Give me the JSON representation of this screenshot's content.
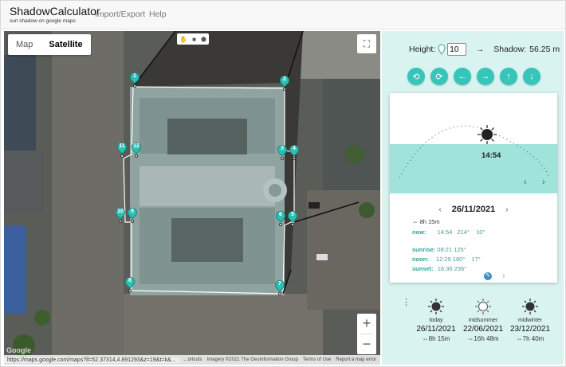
{
  "header": {
    "title": "ShadowCalculator",
    "subtitle": "sun shadow on google maps",
    "nav": [
      "Import/Export",
      "Help"
    ]
  },
  "map": {
    "type_map": "Map",
    "type_satellite": "Satellite",
    "zoom_in": "+",
    "zoom_out": "−",
    "fullscreen_glyph": "⛶",
    "logo": "Google",
    "status_url": "https://maps.google.com/maps?ll=52.37314,4.891293&z=19&t=k&...",
    "footer": [
      "...ortcuts",
      "Imagery ©2021 The GeoInformation Group",
      "Terms of Use",
      "Report a map error"
    ],
    "markers": [
      "1",
      "2",
      "3",
      "4",
      "5",
      "6",
      "7",
      "8",
      "9",
      "10",
      "11",
      "12"
    ]
  },
  "panel": {
    "height_label": "Height:",
    "height_value": "10",
    "arrow": "→",
    "shadow_label": "Shadow:",
    "shadow_value": "56.25 m",
    "controls": [
      "rotate-ccw-icon",
      "rotate-cw-icon",
      "arrow-left-icon",
      "arrow-right-icon",
      "arrow-up-icon",
      "arrow-down-icon"
    ],
    "controls_glyphs": [
      "⟲",
      "⟳",
      "←",
      "→",
      "↑",
      "↓"
    ],
    "sky": {
      "time": "14:54",
      "prev": "‹",
      "next": "›"
    },
    "date": {
      "prev": "‹",
      "value": "26/11/2021",
      "next": "›"
    },
    "day_length": "⇔ 8h 15m",
    "now": {
      "label": "now:",
      "time": "14:54",
      "azimuth": "214°",
      "altitude": "10°"
    },
    "sunrise": {
      "label": "sunrise:",
      "time": "08:21",
      "azimuth": "125°"
    },
    "noon": {
      "label": "noon:",
      "time": "12:29",
      "azimuth": "180°",
      "altitude": "17°"
    },
    "sunset": {
      "label": "sunset:",
      "time": "16:36",
      "azimuth": "236°"
    },
    "card_icons": {
      "compass": "✎",
      "up": "↑"
    },
    "kebab": "⋮",
    "days": [
      {
        "name": "today",
        "date": "26/11/2021",
        "length": "⇔8h 15m"
      },
      {
        "name": "midsummer",
        "date": "22/06/2021",
        "length": "⇔16h 48m"
      },
      {
        "name": "midwinter",
        "date": "23/12/2021",
        "length": "⇔7h 40m"
      }
    ]
  },
  "colors": {
    "accent": "#36c5b8",
    "panel_bg": "#d9f3f0",
    "sky_band": "#9fe3db",
    "marker": "#2ec0b4",
    "label_teal": "#26a69a"
  }
}
